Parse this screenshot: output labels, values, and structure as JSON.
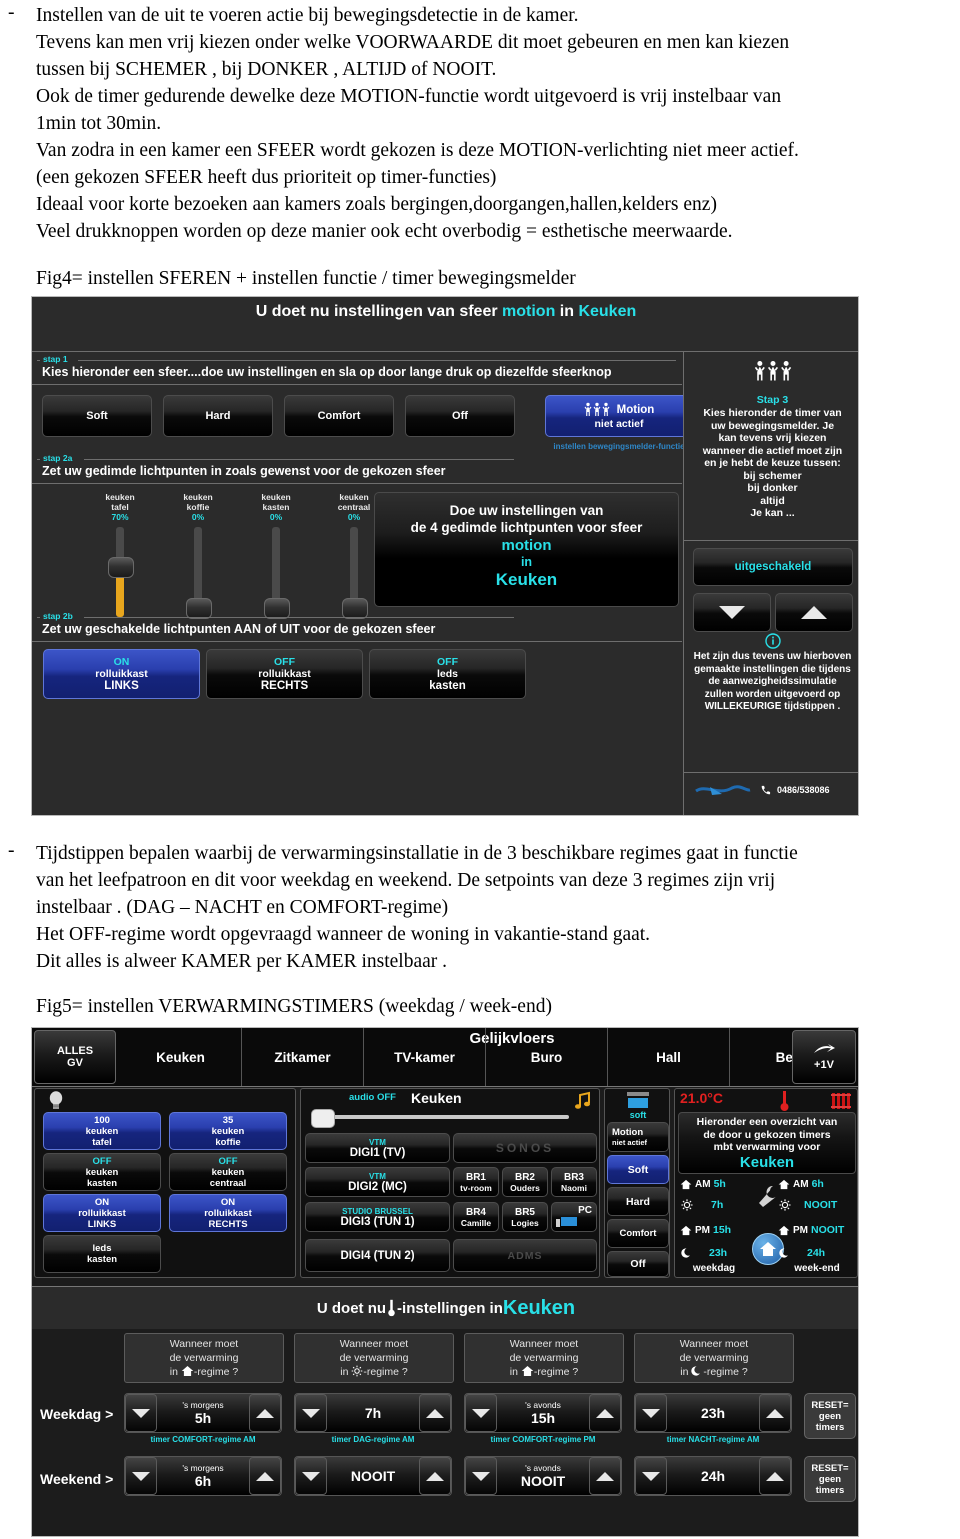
{
  "doc": {
    "bullet1": {
      "marker": "-",
      "lines": [
        "Instellen van de uit te voeren actie bij bewegingsdetectie in de kamer.",
        "Tevens kan men vrij kiezen onder welke VOORWAARDE dit moet gebeuren en men kan kiezen",
        "tussen bij SCHEMER , bij DONKER , ALTIJD of NOOIT.",
        "Ook de timer gedurende dewelke deze MOTION-functie wordt uitgevoerd is vrij instelbaar van",
        "1min tot 30min.",
        "Van zodra in een kamer een SFEER wordt gekozen is deze MOTION-verlichting niet meer actief.",
        "(een gekozen SFEER heeft dus prioriteit op timer-functies)",
        "Ideaal voor korte bezoeken aan kamers zoals bergingen,doorgangen,hallen,kelders enz)",
        "Veel drukknoppen worden op deze manier ook echt overbodig = esthetische meerwaarde."
      ]
    },
    "fig4_caption": "Fig4= instellen SFEREN + instellen functie / timer bewegingsmelder",
    "bullet2": {
      "marker": "-",
      "lines": [
        "Tijdstippen bepalen waarbij de verwarmingsinstallatie in de 3 beschikbare regimes gaat in functie",
        "van het leefpatroon en dit voor weekdag en weekend. De setpoints van deze 3 regimes zijn vrij",
        "instelbaar . (DAG – NACHT en COMFORT-regime)",
        "Het OFF-regime wordt opgevraagd wanneer de woning in vakantie-stand gaat.",
        "Dit alles is alweer KAMER per KAMER instelbaar ."
      ]
    },
    "fig5_caption": "Fig5= instellen VERWARMINGSTIMERS (weekdag / week-end)"
  },
  "fig4": {
    "header": {
      "prefix": "U doet nu instellingen van sfeer ",
      "accent1": "motion",
      "mid": " in ",
      "accent2": "Keuken"
    },
    "stap1": {
      "label": "stap 1",
      "instruction": "Kies hieronder een sfeer....doe uw instellingen en sla op door lange druk op diezelfde sfeerknop"
    },
    "sfeer_buttons": [
      "Soft",
      "Hard",
      "Comfort",
      "Off"
    ],
    "motion_button": {
      "icon": "motion-people-icon",
      "title": "Motion",
      "state": "niet actief"
    },
    "motion_caption": "instellen bewegingsmelder-functie",
    "stap2a": {
      "label": "stap 2a",
      "instruction": "Zet uw gedimde lichtpunten in zoals gewenst voor de gekozen sfeer"
    },
    "dimmers": [
      {
        "line1": "keuken",
        "line2": "tafel",
        "value": "70%",
        "pct": 70
      },
      {
        "line1": "keuken",
        "line2": "koffie",
        "value": "0%",
        "pct": 0
      },
      {
        "line1": "keuken",
        "line2": "kasten",
        "value": "0%",
        "pct": 0
      },
      {
        "line1": "keuken",
        "line2": "centraal",
        "value": "0%",
        "pct": 0
      }
    ],
    "center_panel": {
      "l1": "Doe uw instellingen van",
      "l2": "de 4 gedimde lichtpunten voor sfeer",
      "l3": "motion",
      "l4": "in",
      "l5": "Keuken"
    },
    "stap2b": {
      "label": "stap 2b",
      "instruction": "Zet uw geschakelde lichtpunten AAN of UIT voor de gekozen sfeer"
    },
    "switch_buttons": [
      {
        "state": "ON",
        "line1": "rolluikkast",
        "line2": "LINKS",
        "on": true
      },
      {
        "state": "OFF",
        "line1": "rolluikkast",
        "line2": "RECHTS",
        "on": false
      },
      {
        "state": "OFF",
        "line1": "leds",
        "line2": "kasten",
        "on": false
      }
    ],
    "side": {
      "icon": "motion-people-icon",
      "title": "Stap 3",
      "body": [
        "Kies hieronder de timer van",
        "uw bewegingsmelder. Je",
        "kan tevens vrij kiezen",
        "wanneer die actief moet zijn",
        "en je hebt de keuze tussen:",
        "bij schemer",
        "bij donker",
        "altijd",
        "Je kan ..."
      ],
      "timer_button": "uitgeschakeld",
      "down_icon": "arrow-down-icon",
      "up_icon": "arrow-up-icon",
      "info_icon": "info-icon",
      "note": [
        "Het zijn dus tevens uw hierboven",
        "gemaakte instellingen die tijdens",
        "de aanwezigheidssimulatie",
        "zullen worden uitgevoerd op",
        "WILLEKEURIGE tijdstippen ."
      ],
      "phone_icon": "phone-icon",
      "phone": "0486/538086"
    }
  },
  "fig5": {
    "floor_label": "Gelijkvloers",
    "tabs": [
      {
        "l1": "ALLES",
        "l2": "GV",
        "active": true
      },
      {
        "l1": "Keuken",
        "l2": ""
      },
      {
        "l1": "Zitkamer",
        "l2": ""
      },
      {
        "l1": "TV-kamer",
        "l2": ""
      },
      {
        "l1": "Buro",
        "l2": ""
      },
      {
        "l1": "Hall",
        "l2": ""
      },
      {
        "l1": "Berg",
        "l2": ""
      }
    ],
    "next_floor": {
      "icon": "arrow-right-icon",
      "label": "+1V"
    },
    "lamp_icon": "lightbulb-icon",
    "light_buttons": [
      {
        "state": "100",
        "line1": "keuken",
        "line2": "tafel",
        "on": true
      },
      {
        "state": "35",
        "line1": "keuken",
        "line2": "koffie",
        "on": true
      },
      {
        "state": "OFF",
        "line1": "keuken",
        "line2": "kasten",
        "on": false
      },
      {
        "state": "OFF",
        "line1": "keuken",
        "line2": "centraal",
        "on": false
      },
      {
        "state": "ON",
        "line1": "rolluikkast",
        "line2": "LINKS",
        "on": true
      },
      {
        "state": "ON",
        "line1": "rolluikkast",
        "line2": "RECHTS",
        "on": true
      },
      {
        "state": "",
        "line1": "leds",
        "line2": "kasten",
        "on": false
      }
    ],
    "audio": {
      "status": "audio OFF",
      "room": "Keuken",
      "note_icon": "music-note-icon",
      "volume": 5,
      "sources": [
        {
          "station": "VTM",
          "name": "DIGI1 (TV)"
        },
        {
          "station": "VTM",
          "name": "DIGI2 (MC)"
        },
        {
          "station": "STUDIO BRUSSEL",
          "name": "DIGI3 (TUN 1)"
        },
        {
          "station": "",
          "name": "DIGI4 (TUN 2)"
        }
      ],
      "sonos_label": "SONOS",
      "zones": [
        {
          "l1": "BR1",
          "l2": "tv-room"
        },
        {
          "l1": "BR2",
          "l2": "Ouders"
        },
        {
          "l1": "BR3",
          "l2": "Naomi"
        },
        {
          "l1": "BR4",
          "l2": "Camille"
        },
        {
          "l1": "BR5",
          "l2": "Logies"
        },
        {
          "l1": "PC",
          "l2": ""
        }
      ],
      "adms_label": "ADMS"
    },
    "sfeer": {
      "top_icon": "blinds-icon",
      "top_label": "soft",
      "motion": {
        "title": "Motion",
        "state": "niet actief",
        "icon": "motion-arrow-icon"
      },
      "buttons": [
        {
          "label": "Soft",
          "active": true
        },
        {
          "label": "Hard",
          "active": false
        },
        {
          "label": "Comfort",
          "active": false
        },
        {
          "label": "Off",
          "active": false
        }
      ]
    },
    "heating": {
      "temperature": "21.0°C",
      "thermo_icon": "thermometer-icon",
      "radiator_icon": "radiator-icon",
      "overview": {
        "l1": "Hieronder een overzicht van",
        "l2": "de door u gekozen timers",
        "l3": "mbt verwarming voor",
        "room": "Keuken"
      },
      "wrench_icon": "wrench-icon",
      "home_icon": "home-icon",
      "weekdag_label": "weekdag",
      "weekend_label": "week-end",
      "rows": [
        {
          "icon": "home-icon",
          "period": "AM",
          "weekdag": "5h",
          "weekend": "6h"
        },
        {
          "icon": "sun-icon",
          "period": "",
          "weekdag": "7h",
          "weekend": "NOOIT"
        },
        {
          "icon": "home-icon",
          "period": "PM",
          "weekdag": "15h",
          "weekend": "NOOIT"
        },
        {
          "icon": "moon-icon",
          "period": "",
          "weekdag": "23h",
          "weekend": "24h"
        }
      ]
    },
    "banner": {
      "prefix": "U doet nu ",
      "icon": "thermometer-icon",
      "suffix": "-instellingen in ",
      "room": "Keuken"
    },
    "regime_cards": [
      {
        "l1": "Wanneer moet",
        "l2": "de verwarming",
        "l3_pre": "in ",
        "icon": "home-icon",
        "l3_post": "-regime ?"
      },
      {
        "l1": "Wanneer moet",
        "l2": "de verwarming",
        "l3_pre": "in ",
        "icon": "sun-icon",
        "l3_post": "-regime ?"
      },
      {
        "l1": "Wanneer moet",
        "l2": "de verwarming",
        "l3_pre": "in ",
        "icon": "home-icon",
        "l3_post": "-regime ?"
      },
      {
        "l1": "Wanneer moet",
        "l2": "de verwarming",
        "l3_pre": "in ",
        "icon": "moon-icon",
        "l3_post": "-regime ?"
      }
    ],
    "row_labels": {
      "weekdag": "Weekdag >",
      "weekend": "Weekend >"
    },
    "weekdag_steppers": [
      {
        "top": "'s morgens",
        "value": "5h",
        "caption": "timer COMFORT-regime AM"
      },
      {
        "top": "",
        "value": "7h",
        "caption": "timer DAG-regime AM"
      },
      {
        "top": "'s avonds",
        "value": "15h",
        "caption": "timer COMFORT-regime PM"
      },
      {
        "top": "",
        "value": "23h",
        "caption": "timer NACHT-regime AM"
      }
    ],
    "weekend_steppers": [
      {
        "top": "'s morgens",
        "value": "6h",
        "caption": ""
      },
      {
        "top": "",
        "value": "NOOIT",
        "caption": ""
      },
      {
        "top": "'s avonds",
        "value": "NOOIT",
        "caption": ""
      },
      {
        "top": "",
        "value": "24h",
        "caption": ""
      }
    ],
    "reset_button": {
      "l1": "RESET=",
      "l2": "geen",
      "l3": "timers"
    },
    "colors": {
      "accent": "#29e0e8",
      "active_blue": "#2438a8",
      "temp_red": "#e02020",
      "dimmer_amber": "#e8a61d"
    }
  }
}
